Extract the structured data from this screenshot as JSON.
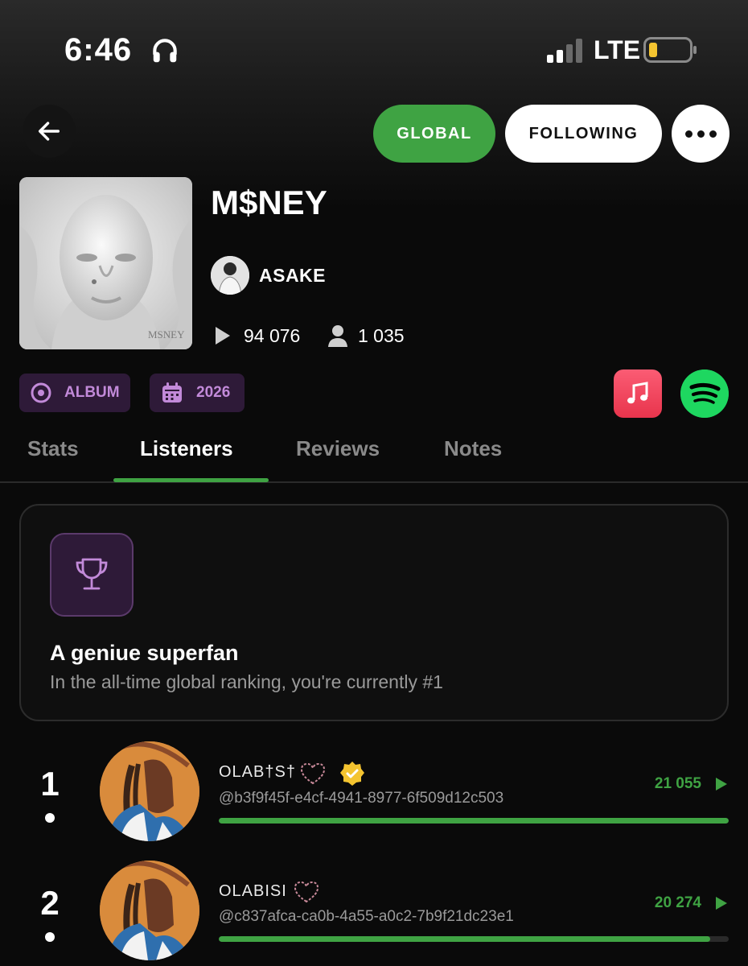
{
  "status_bar": {
    "time": "6:46",
    "network": "LTE"
  },
  "header": {
    "global_label": "GLOBAL",
    "following_label": "FOLLOWING"
  },
  "album": {
    "title": "M$NEY",
    "cover_text": "MSNEY",
    "artist": "ASAKE",
    "plays": "94 076",
    "listeners": "1 035",
    "type_tag": "ALBUM",
    "year_tag": "2026"
  },
  "tabs": [
    {
      "label": "Stats",
      "active": false
    },
    {
      "label": "Listeners",
      "active": true
    },
    {
      "label": "Reviews",
      "active": false
    },
    {
      "label": "Notes",
      "active": false
    }
  ],
  "superfan": {
    "title": "A geniue superfan",
    "subtitle": "In the all-time global ranking, you're currently #1"
  },
  "ranking": [
    {
      "rank": "1",
      "name": "OLAB†S†",
      "handle": "@b3f9f45f-e4cf-4941-8977-6f509d12c503",
      "plays": "21 055",
      "progress": 1.0,
      "verified": true
    },
    {
      "rank": "2",
      "name": "OLABISI",
      "handle": "@c837afca-ca0b-4a55-a0c2-7b9f21dc23e1",
      "plays": "20 274",
      "progress": 0.963,
      "verified": false
    }
  ],
  "colors": {
    "accent_green": "#3fa343",
    "tag_purple": "#2e1a38",
    "tag_text": "#c28ad9"
  }
}
